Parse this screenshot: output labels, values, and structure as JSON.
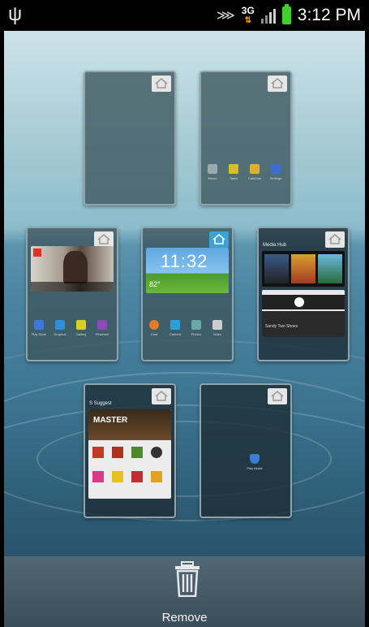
{
  "status_bar": {
    "time": "3:12 PM",
    "network": "3G",
    "icons": [
      "usb-icon",
      "no-signal-icon",
      "3g-icon",
      "signal-bars-icon",
      "battery-icon"
    ]
  },
  "homescreens": [
    {
      "id": 1,
      "is_home": false,
      "apps": []
    },
    {
      "id": 2,
      "is_home": false,
      "apps": [
        {
          "label": "Memo",
          "icon": "clip-icon",
          "color": "#9aa"
        },
        {
          "label": "Tasks",
          "icon": "tasks-icon",
          "color": "#d8c020"
        },
        {
          "label": "Calendar",
          "icon": "calendar-icon",
          "color": "#e0b030"
        },
        {
          "label": "Settings",
          "icon": "gear-icon",
          "color": "#3a6ed0"
        }
      ]
    },
    {
      "id": 3,
      "is_home": false,
      "widget": "Flipboard",
      "apps": [
        {
          "label": "Play Store",
          "icon": "play-icon",
          "color": "#3b79d8"
        },
        {
          "label": "Dropbox",
          "icon": "dropbox-icon",
          "color": "#2f8ed8"
        },
        {
          "label": "Gallery",
          "icon": "gallery-icon",
          "color": "#d8d020"
        },
        {
          "label": "Pinwheel",
          "icon": "pinwheel-icon",
          "color": "#8a4ab8"
        }
      ]
    },
    {
      "id": 4,
      "is_home": true,
      "widget": "Clock",
      "clock_time": "11:32",
      "apps": [
        {
          "label": "Chat",
          "icon": "chat-icon",
          "color": "#e27b28"
        },
        {
          "label": "Camera",
          "icon": "camera-icon",
          "color": "#2b9fd8"
        },
        {
          "label": "Photos",
          "icon": "photos-icon",
          "color": "#6aa"
        },
        {
          "label": "Video",
          "icon": "video-icon",
          "color": "#ccc"
        }
      ]
    },
    {
      "id": 5,
      "is_home": false,
      "widget": "Media Hub",
      "widget_title": "Media Hub",
      "track": "Sandy Two Shoes",
      "apps": []
    },
    {
      "id": 6,
      "is_home": false,
      "widget": "S Suggest",
      "widget_title": "S Suggest",
      "banner": "MASTER",
      "apps": []
    },
    {
      "id": 7,
      "is_home": false,
      "apps": [
        {
          "label": "Play Music",
          "icon": "shield-icon",
          "color": "#3a7ed8"
        }
      ]
    }
  ],
  "remove_bar": {
    "label": "Remove",
    "icon": "trash-icon"
  }
}
